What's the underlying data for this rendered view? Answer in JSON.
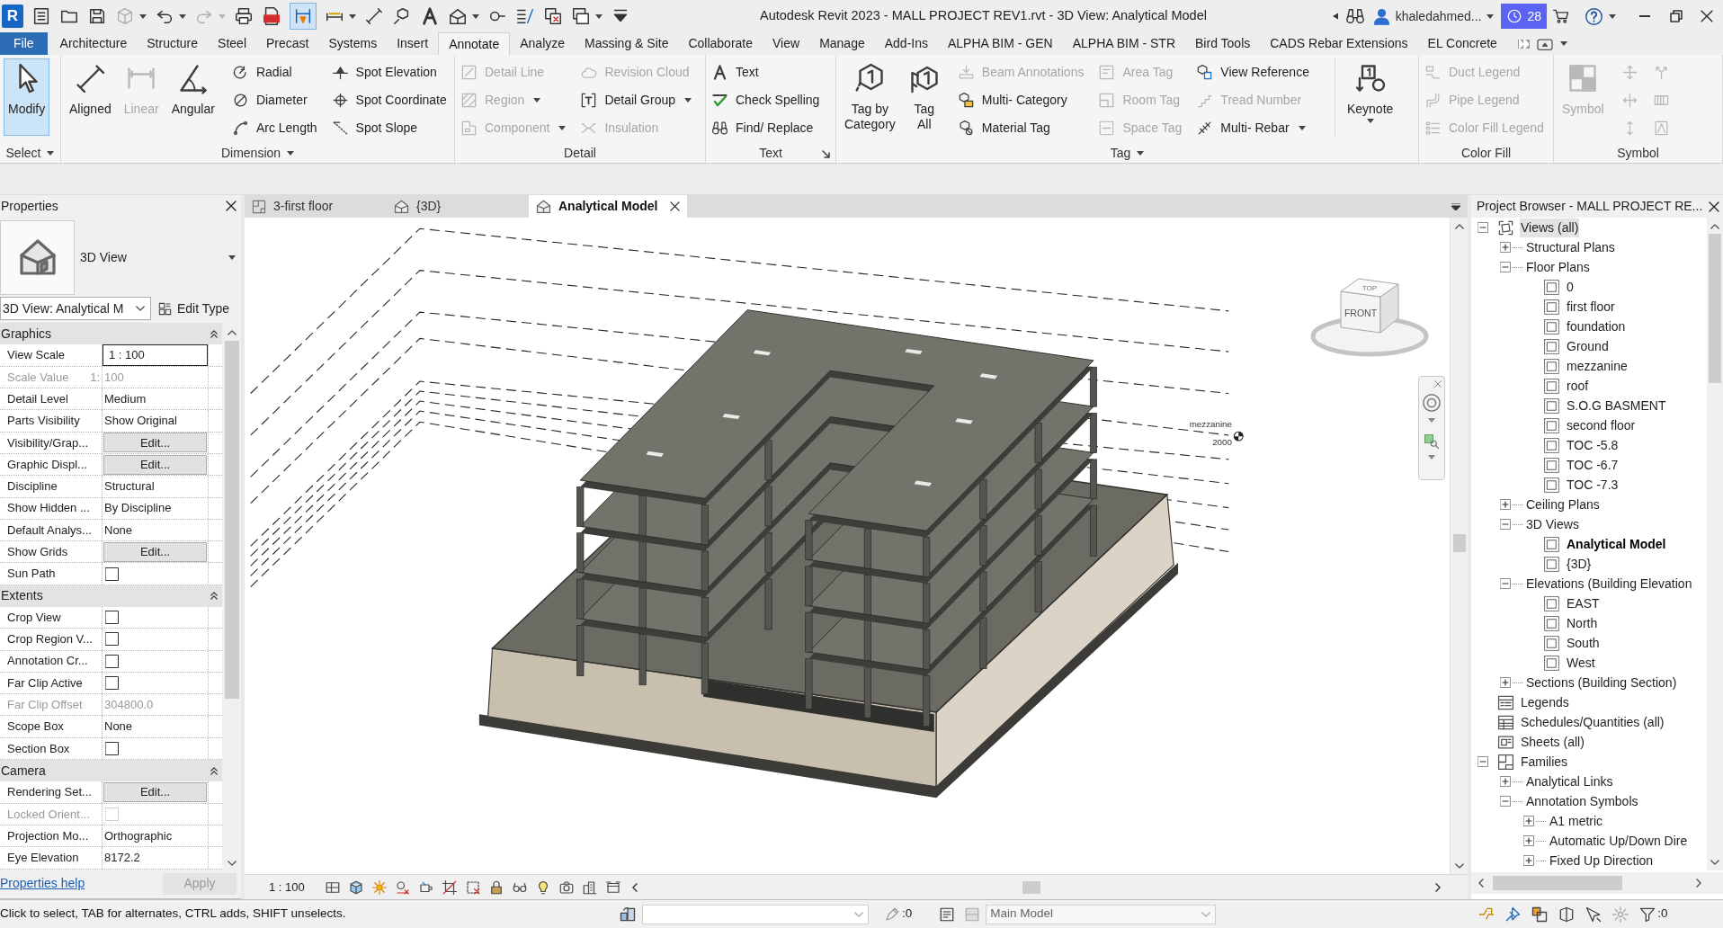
{
  "title_bar": {
    "logo": "R",
    "title": "Autodesk Revit 2023 - MALL PROJECT REV1.rvt - 3D View: Analytical Model",
    "user": "khaledahmed...",
    "notification_count": "28"
  },
  "ribbon_tabs": [
    {
      "label": "File",
      "kind": "file",
      "selected": false
    },
    {
      "label": "Architecture",
      "kind": "tab",
      "selected": false
    },
    {
      "label": "Structure",
      "kind": "tab",
      "selected": false
    },
    {
      "label": "Steel",
      "kind": "tab",
      "selected": false
    },
    {
      "label": "Precast",
      "kind": "tab",
      "selected": false
    },
    {
      "label": "Systems",
      "kind": "tab",
      "selected": false
    },
    {
      "label": "Insert",
      "kind": "tab",
      "selected": false
    },
    {
      "label": "Annotate",
      "kind": "tab",
      "selected": true
    },
    {
      "label": "Analyze",
      "kind": "tab",
      "selected": false
    },
    {
      "label": "Massing & Site",
      "kind": "tab",
      "selected": false
    },
    {
      "label": "Collaborate",
      "kind": "tab",
      "selected": false
    },
    {
      "label": "View",
      "kind": "tab",
      "selected": false
    },
    {
      "label": "Manage",
      "kind": "tab",
      "selected": false
    },
    {
      "label": "Add-Ins",
      "kind": "tab",
      "selected": false
    },
    {
      "label": "ALPHA BIM - GEN",
      "kind": "tab",
      "selected": false
    },
    {
      "label": "ALPHA BIM - STR",
      "kind": "tab",
      "selected": false
    },
    {
      "label": "Bird Tools",
      "kind": "tab",
      "selected": false
    },
    {
      "label": "CADS Rebar Extensions",
      "kind": "tab",
      "selected": false
    },
    {
      "label": "EL Concrete",
      "kind": "tab",
      "selected": false
    }
  ],
  "ribbon_panels": [
    {
      "title": "Select",
      "menu": true,
      "launcher": false,
      "tools": [
        {
          "label": "Modify",
          "kind": "large",
          "active": true,
          "disabled": false,
          "dropdown": false
        }
      ]
    },
    {
      "title": "Dimension",
      "menu": true,
      "launcher": false,
      "tools": [
        {
          "label": "Aligned",
          "kind": "large",
          "active": false,
          "disabled": false,
          "dropdown": false
        },
        {
          "label": "Linear",
          "kind": "large",
          "active": false,
          "disabled": true,
          "dropdown": false
        },
        {
          "label": "Angular",
          "kind": "large",
          "active": false,
          "disabled": false,
          "dropdown": false
        },
        {
          "label": "Radial",
          "kind": "small",
          "active": false,
          "disabled": false,
          "dropdown": false
        },
        {
          "label": "Diameter",
          "kind": "small",
          "active": false,
          "disabled": false,
          "dropdown": false
        },
        {
          "label": "Arc Length",
          "kind": "small",
          "active": false,
          "disabled": false,
          "dropdown": false
        },
        {
          "label": "Spot Elevation",
          "kind": "small",
          "active": false,
          "disabled": false,
          "dropdown": false
        },
        {
          "label": "Spot Coordinate",
          "kind": "small",
          "active": false,
          "disabled": false,
          "dropdown": false
        },
        {
          "label": "Spot Slope",
          "kind": "small",
          "active": false,
          "disabled": false,
          "dropdown": false
        }
      ]
    },
    {
      "title": "Detail",
      "menu": false,
      "launcher": false,
      "tools": [
        {
          "label": "Detail Line",
          "kind": "small",
          "active": false,
          "disabled": true,
          "dropdown": false
        },
        {
          "label": "Region",
          "kind": "small",
          "active": false,
          "disabled": true,
          "dropdown": true
        },
        {
          "label": "Component",
          "kind": "small",
          "active": false,
          "disabled": true,
          "dropdown": true
        },
        {
          "label": "Revision Cloud",
          "kind": "small",
          "active": false,
          "disabled": true,
          "dropdown": false
        },
        {
          "label": "Detail Group",
          "kind": "small",
          "active": false,
          "disabled": false,
          "dropdown": true
        },
        {
          "label": "Insulation",
          "kind": "small",
          "active": false,
          "disabled": true,
          "dropdown": false
        }
      ]
    },
    {
      "title": "Text",
      "menu": false,
      "launcher": true,
      "tools": [
        {
          "label": "Text",
          "kind": "small",
          "active": false,
          "disabled": false,
          "dropdown": false
        },
        {
          "label": "Check Spelling",
          "kind": "small",
          "active": false,
          "disabled": false,
          "dropdown": false
        },
        {
          "label": "Find/ Replace",
          "kind": "small",
          "active": false,
          "disabled": false,
          "dropdown": false
        }
      ]
    },
    {
      "title": "Tag",
      "menu": true,
      "launcher": false,
      "tools": [
        {
          "label": "Tag by Category",
          "kind": "large",
          "active": false,
          "disabled": false,
          "dropdown": false
        },
        {
          "label": "Tag All",
          "kind": "large",
          "active": false,
          "disabled": false,
          "dropdown": false
        },
        {
          "label": "Beam Annotations",
          "kind": "small",
          "active": false,
          "disabled": true,
          "dropdown": false
        },
        {
          "label": "Multi- Category",
          "kind": "small",
          "active": false,
          "disabled": false,
          "dropdown": false
        },
        {
          "label": "Material Tag",
          "kind": "small",
          "active": false,
          "disabled": false,
          "dropdown": false
        },
        {
          "label": "Area Tag",
          "kind": "small",
          "active": false,
          "disabled": true,
          "dropdown": false
        },
        {
          "label": "Room Tag",
          "kind": "small",
          "active": false,
          "disabled": true,
          "dropdown": false
        },
        {
          "label": "Space Tag",
          "kind": "small",
          "active": false,
          "disabled": true,
          "dropdown": false
        },
        {
          "label": "View Reference",
          "kind": "small",
          "active": false,
          "disabled": false,
          "dropdown": false
        },
        {
          "label": "Tread Number",
          "kind": "small",
          "active": false,
          "disabled": true,
          "dropdown": false
        },
        {
          "label": "Multi- Rebar",
          "kind": "small",
          "active": false,
          "disabled": false,
          "dropdown": true
        },
        {
          "label": "Keynote",
          "kind": "large",
          "active": false,
          "disabled": false,
          "dropdown": true
        }
      ]
    },
    {
      "title": "Color Fill",
      "menu": false,
      "launcher": false,
      "tools": [
        {
          "label": "Duct Legend",
          "kind": "small",
          "active": false,
          "disabled": true,
          "dropdown": false
        },
        {
          "label": "Pipe Legend",
          "kind": "small",
          "active": false,
          "disabled": true,
          "dropdown": false
        },
        {
          "label": "Color Fill Legend",
          "kind": "small",
          "active": false,
          "disabled": true,
          "dropdown": false
        }
      ]
    },
    {
      "title": "Symbol",
      "menu": false,
      "launcher": false,
      "tools": [
        {
          "label": "Symbol",
          "kind": "large",
          "active": false,
          "disabled": true,
          "dropdown": false
        },
        {
          "kind": "icon",
          "active": false,
          "disabled": true,
          "dropdown": false
        },
        {
          "kind": "icon",
          "active": false,
          "disabled": true,
          "dropdown": false
        },
        {
          "kind": "icon",
          "active": false,
          "disabled": true,
          "dropdown": false
        },
        {
          "kind": "icon",
          "active": false,
          "disabled": true,
          "dropdown": false
        },
        {
          "kind": "icon",
          "active": false,
          "disabled": true,
          "dropdown": false
        },
        {
          "kind": "icon",
          "active": false,
          "disabled": true,
          "dropdown": false
        }
      ]
    }
  ],
  "properties": {
    "title": "Properties",
    "type_name": "3D View",
    "view_selector": "3D View: Analytical M",
    "edit_type": "Edit Type",
    "groups": [
      {
        "name": "Graphics",
        "expanded": true,
        "rows": [
          {
            "name": "View Scale",
            "kind": "input",
            "value": "1 : 100",
            "disabled": false
          },
          {
            "name": "Scale Value",
            "unit": "1:",
            "kind": "text",
            "value": "100",
            "disabled": true
          },
          {
            "name": "Detail Level",
            "kind": "text",
            "value": "Medium",
            "disabled": false
          },
          {
            "name": "Parts Visibility",
            "kind": "text",
            "value": "Show Original",
            "disabled": false
          },
          {
            "name": "Visibility/Grap...",
            "kind": "button",
            "value": "Edit...",
            "disabled": false
          },
          {
            "name": "Graphic Displ...",
            "kind": "button",
            "value": "Edit...",
            "disabled": false
          },
          {
            "name": "Discipline",
            "kind": "text",
            "value": "Structural",
            "disabled": false
          },
          {
            "name": "Show Hidden ...",
            "kind": "text",
            "value": "By Discipline",
            "disabled": false
          },
          {
            "name": "Default Analys...",
            "kind": "text",
            "value": "None",
            "disabled": false
          },
          {
            "name": "Show Grids",
            "kind": "button",
            "value": "Edit...",
            "disabled": false
          },
          {
            "name": "Sun Path",
            "kind": "checkbox",
            "checked": false,
            "disabled": false
          }
        ]
      },
      {
        "name": "Extents",
        "expanded": true,
        "rows": [
          {
            "name": "Crop View",
            "kind": "checkbox",
            "checked": false,
            "disabled": false
          },
          {
            "name": "Crop Region V...",
            "kind": "checkbox",
            "checked": false,
            "disabled": false
          },
          {
            "name": "Annotation Cr...",
            "kind": "checkbox",
            "checked": false,
            "disabled": false
          },
          {
            "name": "Far Clip Active",
            "kind": "checkbox",
            "checked": false,
            "disabled": false
          },
          {
            "name": "Far Clip Offset",
            "kind": "text",
            "value": "304800.0",
            "disabled": true
          },
          {
            "name": "Scope Box",
            "kind": "text",
            "value": "None",
            "disabled": false
          },
          {
            "name": "Section Box",
            "kind": "checkbox",
            "checked": false,
            "disabled": false
          }
        ]
      },
      {
        "name": "Camera",
        "expanded": true,
        "rows": [
          {
            "name": "Rendering Set...",
            "kind": "button",
            "value": "Edit...",
            "disabled": false
          },
          {
            "name": "Locked Orient...",
            "kind": "checkbox",
            "checked": false,
            "disabled": true
          },
          {
            "name": "Projection Mo...",
            "kind": "text",
            "value": "Orthographic",
            "disabled": false
          },
          {
            "name": "Eye Elevation",
            "kind": "text",
            "value": "8172.2",
            "disabled": false
          }
        ]
      }
    ],
    "help": "Properties help",
    "apply": "Apply",
    "apply_disabled": true
  },
  "view": {
    "tabs": [
      {
        "label": "3-first floor",
        "kind": "plan",
        "selected": false
      },
      {
        "label": "{3D}",
        "kind": "model",
        "selected": false
      },
      {
        "label": "Analytical Model",
        "kind": "model",
        "selected": true
      }
    ],
    "level_marker": {
      "name": "mezzanine",
      "elevation": "2000"
    },
    "view_cube": {
      "front": "FRONT",
      "top": "TOP"
    },
    "scale": "1 : 100"
  },
  "project_browser": {
    "title": "Project Browser - MALL PROJECT RE...",
    "tree": [
      {
        "label": "Views (all)",
        "kind": "views",
        "expanded": true,
        "selected": true,
        "children": [
          {
            "label": "Structural Plans",
            "kind": "folder",
            "expanded": false,
            "selected": false
          },
          {
            "label": "Floor Plans",
            "kind": "folder",
            "expanded": true,
            "selected": false,
            "children": [
              {
                "label": "0",
                "kind": "view",
                "selected": false,
                "active": false
              },
              {
                "label": "first floor",
                "kind": "view",
                "selected": false,
                "active": false
              },
              {
                "label": "foundation",
                "kind": "view",
                "selected": false,
                "active": false
              },
              {
                "label": "Ground",
                "kind": "view",
                "selected": false,
                "active": false
              },
              {
                "label": "mezzanine",
                "kind": "view",
                "selected": false,
                "active": false
              },
              {
                "label": "roof",
                "kind": "view",
                "selected": false,
                "active": false
              },
              {
                "label": "S.O.G BASMENT",
                "kind": "view",
                "selected": false,
                "active": false
              },
              {
                "label": "second floor",
                "kind": "view",
                "selected": false,
                "active": false
              },
              {
                "label": "TOC -5.8",
                "kind": "view",
                "selected": false,
                "active": false
              },
              {
                "label": "TOC -6.7",
                "kind": "view",
                "selected": false,
                "active": false
              },
              {
                "label": "TOC -7.3",
                "kind": "view",
                "selected": false,
                "active": false
              }
            ]
          },
          {
            "label": "Ceiling Plans",
            "kind": "folder",
            "expanded": false,
            "selected": false
          },
          {
            "label": "3D Views",
            "kind": "folder",
            "expanded": true,
            "selected": false,
            "children": [
              {
                "label": "Analytical Model",
                "kind": "view",
                "selected": false,
                "active": true
              },
              {
                "label": "{3D}",
                "kind": "view",
                "selected": false,
                "active": false
              }
            ]
          },
          {
            "label": "Elevations (Building Elevation",
            "kind": "folder",
            "expanded": true,
            "selected": false,
            "children": [
              {
                "label": "EAST",
                "kind": "view",
                "selected": false,
                "active": false
              },
              {
                "label": "North",
                "kind": "view",
                "selected": false,
                "active": false
              },
              {
                "label": "South",
                "kind": "view",
                "selected": false,
                "active": false
              },
              {
                "label": "West",
                "kind": "view",
                "selected": false,
                "active": false
              }
            ]
          },
          {
            "label": "Sections (Building Section)",
            "kind": "folder",
            "expanded": false,
            "selected": false
          }
        ]
      },
      {
        "label": "Legends",
        "kind": "legends",
        "selected": false
      },
      {
        "label": "Schedules/Quantities (all)",
        "kind": "schedules",
        "selected": false
      },
      {
        "label": "Sheets (all)",
        "kind": "sheets",
        "selected": false
      },
      {
        "label": "Families",
        "kind": "families",
        "expanded": true,
        "selected": false,
        "children": [
          {
            "label": "Analytical Links",
            "kind": "folder",
            "expanded": false,
            "selected": false
          },
          {
            "label": "Annotation Symbols",
            "kind": "folder",
            "expanded": true,
            "selected": false,
            "children": [
              {
                "label": "A1 metric",
                "kind": "folder",
                "expanded": false,
                "selected": false
              },
              {
                "label": "Automatic Up/Down Dire",
                "kind": "folder",
                "expanded": false,
                "selected": false
              },
              {
                "label": "Fixed Up Direction",
                "kind": "folder",
                "expanded": false,
                "selected": false
              }
            ]
          }
        ]
      }
    ]
  },
  "status_bar": {
    "message": "Click to select, TAB for alternates, CTRL adds, SHIFT unselects.",
    "count": ":0",
    "design_option": "Main Model",
    "filter_count": ":0"
  }
}
